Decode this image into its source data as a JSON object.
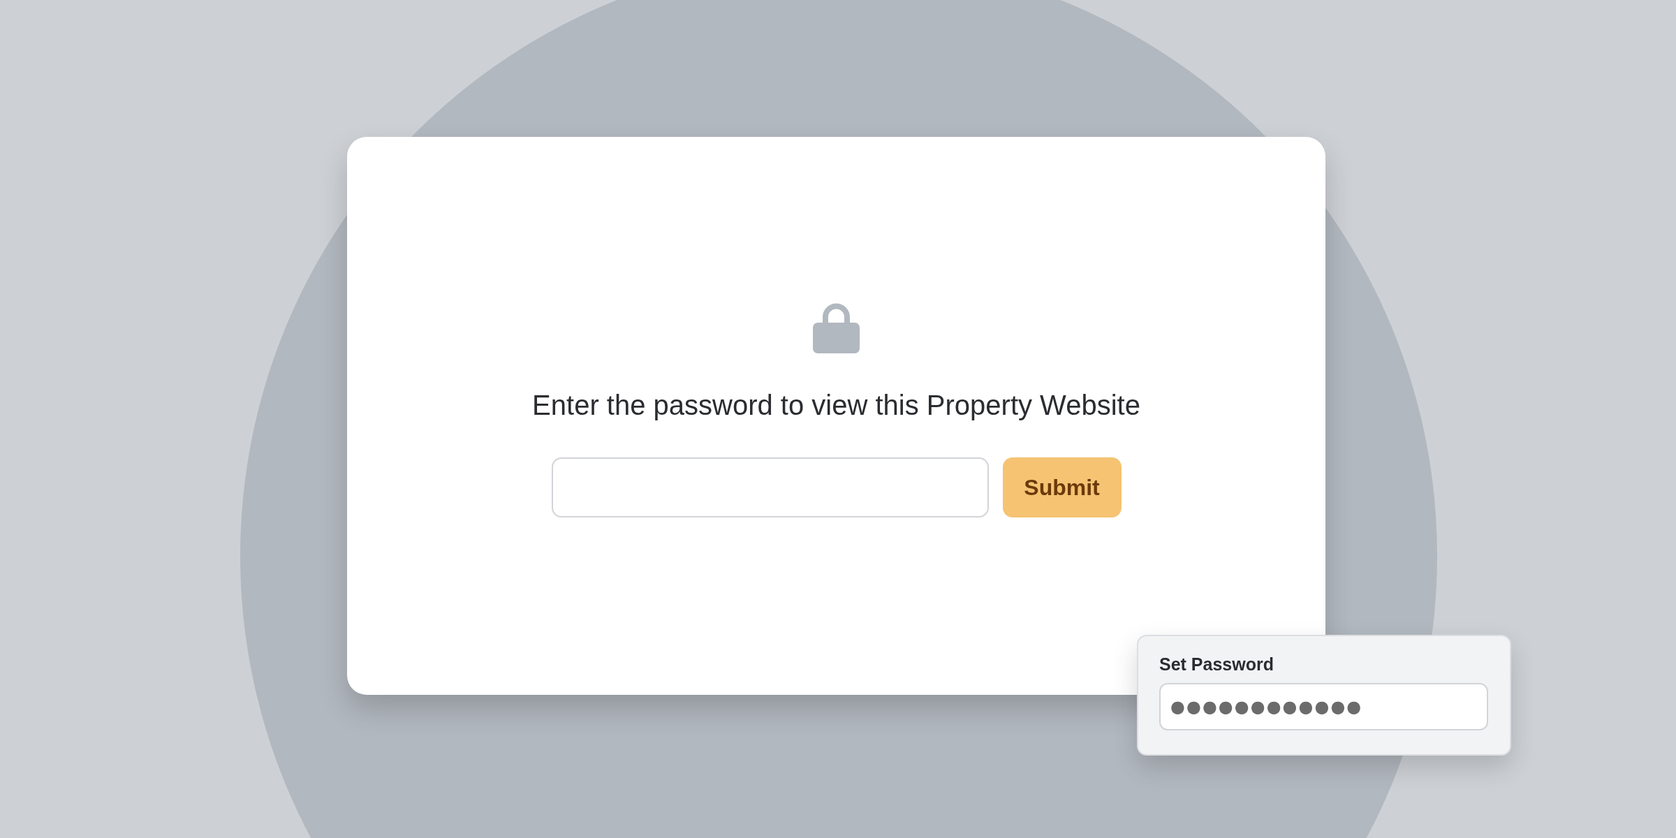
{
  "lock_card": {
    "heading": "Enter the password to view this Property Website",
    "submit_button": "Submit"
  },
  "set_password_panel": {
    "label": "Set Password",
    "value": "●●●●●●●●●●●●"
  }
}
